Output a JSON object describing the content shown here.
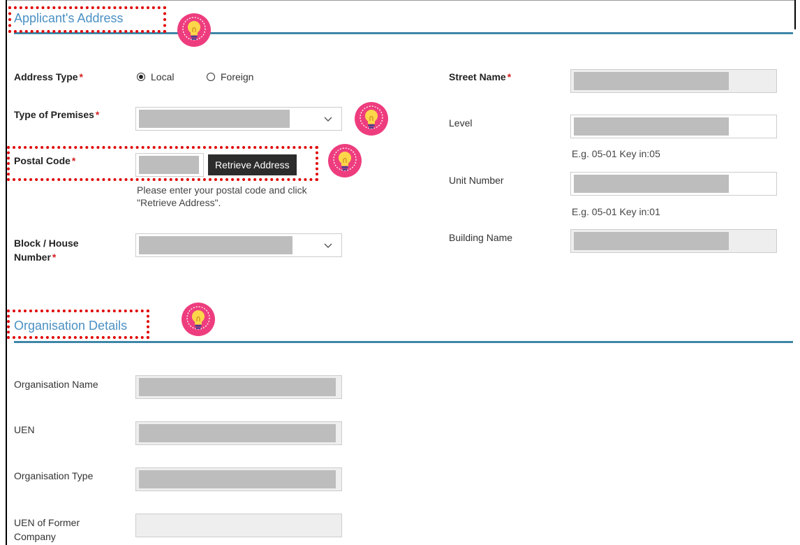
{
  "address_section": {
    "title": "Applicant's Address",
    "address_type": {
      "label": "Address Type",
      "required": "*",
      "options": [
        "Local",
        "Foreign"
      ],
      "selected": "Local"
    },
    "type_of_premises": {
      "label": "Type of Premises",
      "required": "*",
      "value": ""
    },
    "postal_code": {
      "label": "Postal Code",
      "required": "*",
      "value": "",
      "button_label": "Retrieve Address",
      "help_text_line1": "Please enter your postal code and click",
      "help_text_line2": "\"Retrieve Address\"."
    },
    "block_house": {
      "label_line1": "Block / House",
      "label_line2": "Number",
      "required": "*",
      "value": ""
    },
    "street_name": {
      "label": "Street Name",
      "required": "*",
      "value": ""
    },
    "level": {
      "label": "Level",
      "value": "",
      "hint": "E.g. 05-01 Key in:05"
    },
    "unit_number": {
      "label": "Unit Number",
      "value": "",
      "hint": "E.g. 05-01 Key in:01"
    },
    "building_name": {
      "label": "Building Name",
      "value": ""
    }
  },
  "organisation_section": {
    "title": "Organisation Details",
    "organisation_name": {
      "label": "Organisation Name",
      "value": ""
    },
    "uen": {
      "label": "UEN",
      "value": ""
    },
    "organisation_type": {
      "label": "Organisation Type",
      "value": ""
    },
    "uen_former": {
      "label_line1": "UEN of Former",
      "label_line2": "Company",
      "value": ""
    }
  },
  "icons": {
    "tip": "lightbulb-icon",
    "dropdown": "chevron-down-icon",
    "tip_background": "#ee3d7e",
    "bulb_color": "#fdd64a",
    "highlight_color": "#e00000",
    "section_rule_color": "#3e86a8"
  }
}
